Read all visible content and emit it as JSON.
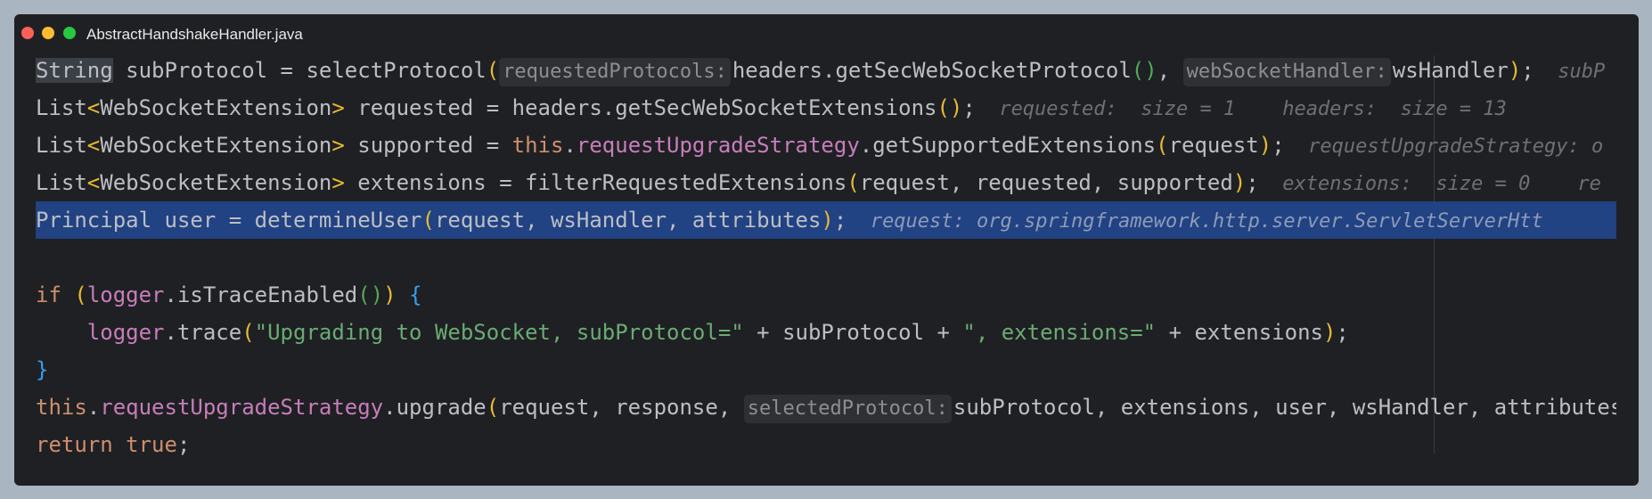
{
  "window": {
    "title": "AbstractHandshakeHandler.java"
  },
  "code": {
    "l1": {
      "t1": "String",
      "t2": " subProtocol = selectProtocol",
      "po": "(",
      "h1": "requestedProtocols:",
      "t3": "headers.getSecWebSocketProtocol",
      "p2o": "()",
      "t4": ", ",
      "h2": "webSocketHandler:",
      "t5": "wsHandler",
      "pc": ")",
      "t6": ";",
      "dbg": "  subP"
    },
    "l2": {
      "t1": "List",
      "lt": "<",
      "t2": "WebSocketExtension",
      "gt": ">",
      "t3": " requested = headers.getSecWebSocketExtensions",
      "p": "()",
      "t4": ";",
      "dbg": "  requested:  size = 1    headers:  size = 13"
    },
    "l3": {
      "t1": "List",
      "lt": "<",
      "t2": "WebSocketExtension",
      "gt": ">",
      "t3": " supported = ",
      "kw": "this",
      "dot": ".",
      "fld": "requestUpgradeStrategy",
      "t4": ".getSupportedExtensions",
      "po": "(",
      "t5": "request",
      "pc": ")",
      "t6": ";",
      "dbg": "  requestUpgradeStrategy: o"
    },
    "l4": {
      "t1": "List",
      "lt": "<",
      "t2": "WebSocketExtension",
      "gt": ">",
      "t3": " extensions = filterRequestedExtensions",
      "po": "(",
      "t4": "request, requested, supported",
      "pc": ")",
      "t5": ";",
      "dbg": "  extensions:  size = 0    re"
    },
    "l5": {
      "t1": "Principal user = determineUser",
      "po": "(",
      "t2": "request, wsHandler, attributes",
      "pc": ")",
      "t3": ";",
      "dbg": "  request: org.springframework.http.server.ServletServerHtt"
    },
    "l7": {
      "kw": "if",
      "sp": " ",
      "po": "(",
      "fld": "logger",
      "t1": ".isTraceEnabled",
      "p2": "()",
      "pc": ")",
      "sp2": " ",
      "br": "{"
    },
    "l8": {
      "indent": "    ",
      "fld": "logger",
      "t1": ".trace",
      "po": "(",
      "s1": "\"Upgrading to WebSocket, subProtocol=\"",
      "t2": " + subProtocol + ",
      "s2": "\", extensions=\"",
      "t3": " + extensions",
      "pc": ")",
      "t4": ";"
    },
    "l9": {
      "br": "}"
    },
    "l10": {
      "kw": "this",
      "dot": ".",
      "fld": "requestUpgradeStrategy",
      "t1": ".upgrade",
      "po": "(",
      "t2": "request, response, ",
      "h1": "selectedProtocol:",
      "t3": "subProtocol, extensions, user, wsHandler, attributes",
      "pc": ")",
      "t4": ";"
    },
    "l11": {
      "kw": "return",
      "sp": " ",
      "kw2": "true",
      "t1": ";"
    }
  }
}
